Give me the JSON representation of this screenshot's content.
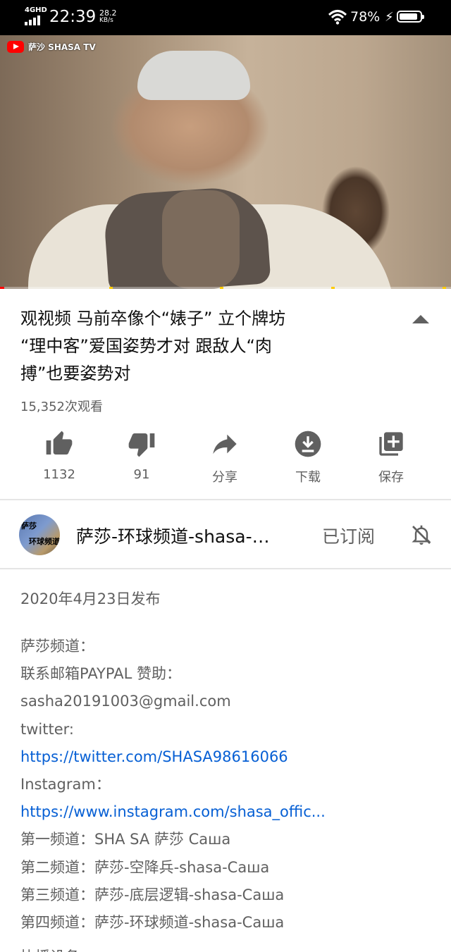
{
  "status_bar": {
    "network": "4GHD",
    "time": "22:39",
    "speed_value": "28.2",
    "speed_unit": "KB/s",
    "battery": "78%"
  },
  "video": {
    "channel_watermark": "萨沙 SHASA TV",
    "progress_fraction": 0.01
  },
  "info": {
    "title": "观视频 马前卒像个“婊子” 立个牌坊“理中客”爱国姿势才对 跟敌人“肉搏”也要姿势对",
    "title_lines": [
      "观视频 马前卒像个“婊子” 立个牌坊",
      "“理中客”爱国姿势才对 跟敌人“肉",
      "搏”也要姿势对"
    ],
    "views": "15,352次观看"
  },
  "actions": [
    {
      "label": "1132",
      "icon": "thumbs-up-icon"
    },
    {
      "label": "91",
      "icon": "thumbs-down-icon"
    },
    {
      "label": "分享",
      "icon": "share-icon"
    },
    {
      "label": "下载",
      "icon": "download-icon"
    },
    {
      "label": "保存",
      "icon": "save-playlist-icon"
    }
  ],
  "channel": {
    "avatar_text_1": "萨莎",
    "avatar_text_2": "环球频道",
    "name": "萨莎-环球频道-shasa-…",
    "subscribed_label": "已订阅"
  },
  "description": {
    "date": "2020年4月23日发布",
    "lines": [
      {
        "text": "萨莎频道：",
        "link": false
      },
      {
        "text": "联系邮箱PAYPAL 赞助：",
        "link": false
      },
      {
        "text": "sasha20191003@gmail.com",
        "link": false
      },
      {
        "text": "twitter:",
        "link": false
      },
      {
        "text": "https://twitter.com/SHASA98616066",
        "link": true
      },
      {
        "text": "Instagram：",
        "link": false
      },
      {
        "text": "https://www.instagram.com/shasa_offic...",
        "link": true
      },
      {
        "text": "第一频道：SHA SA 萨莎 Саша",
        "link": false
      },
      {
        "text": "第二频道：萨莎-空降兵-shasa-Саша",
        "link": false
      },
      {
        "text": "第三频道：萨莎-底层逻辑-shasa-Саша",
        "link": false
      },
      {
        "text": "第四频道：萨莎-环球频道-shasa-Саша",
        "link": false
      }
    ],
    "partial_line": "协播设备"
  },
  "colors": {
    "link": "#065fd4",
    "secondary_text": "#606060",
    "accent_red": "#ff0000"
  }
}
